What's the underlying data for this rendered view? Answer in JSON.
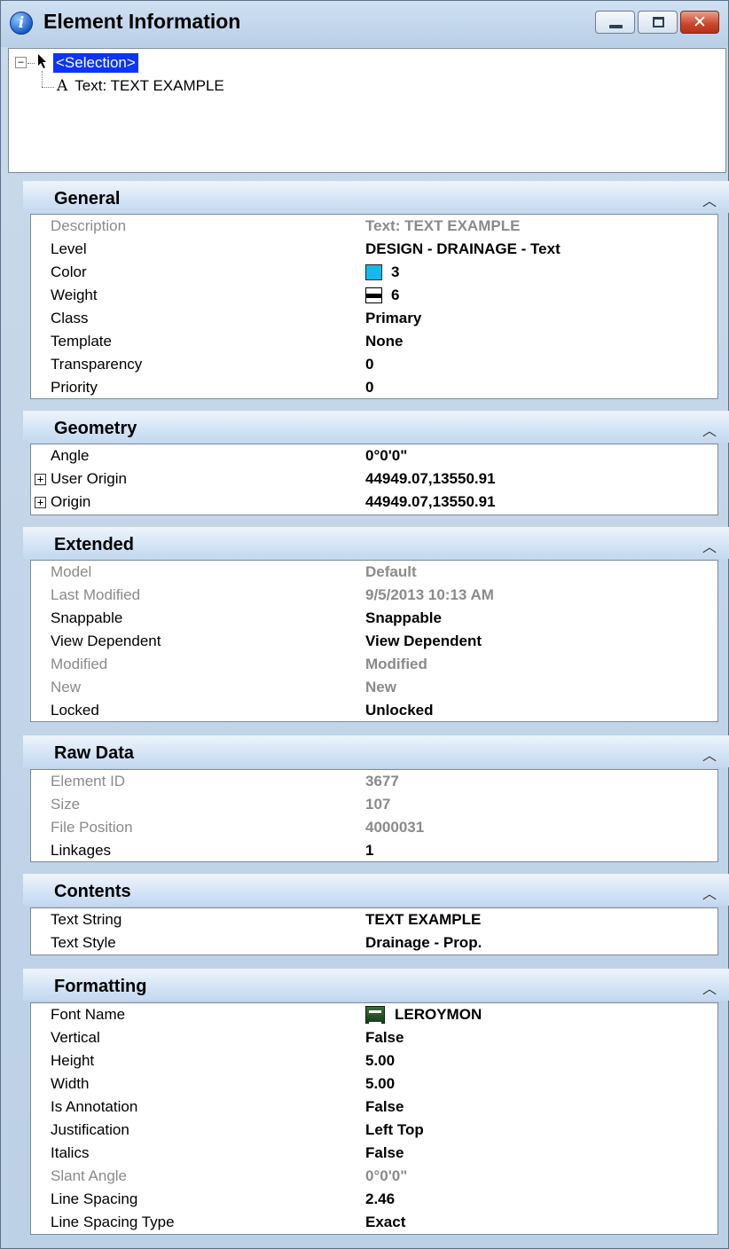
{
  "window": {
    "title": "Element Information",
    "icon": "info-icon"
  },
  "tree": {
    "root_label": "<Selection>",
    "child_icon_glyph": "A",
    "child_label": "Text: TEXT EXAMPLE"
  },
  "colors": {
    "selection_highlight": "#0a34ff",
    "level_color_swatch": "#14b9f0"
  },
  "sections": {
    "general": {
      "title": "General",
      "rows": [
        {
          "key": "Description",
          "value": "Text: TEXT EXAMPLE",
          "disabled": true
        },
        {
          "key": "Level",
          "value": "DESIGN - DRAINAGE - Text"
        },
        {
          "key": "Color",
          "value": "3"
        },
        {
          "key": "Weight",
          "value": "6"
        },
        {
          "key": "Class",
          "value": "Primary"
        },
        {
          "key": "Template",
          "value": "None"
        },
        {
          "key": "Transparency",
          "value": "0"
        },
        {
          "key": "Priority",
          "value": "0"
        }
      ]
    },
    "geometry": {
      "title": "Geometry",
      "rows": [
        {
          "key": "Angle",
          "value": "0°0'0\""
        },
        {
          "key": "User Origin",
          "value": "44949.07,13550.91"
        },
        {
          "key": "Origin",
          "value": "44949.07,13550.91"
        }
      ]
    },
    "extended": {
      "title": "Extended",
      "rows": [
        {
          "key": "Model",
          "value": "Default",
          "disabled": true
        },
        {
          "key": "Last Modified",
          "value": "9/5/2013 10:13 AM",
          "disabled": true
        },
        {
          "key": "Snappable",
          "value": "Snappable"
        },
        {
          "key": "View Dependent",
          "value": "View Dependent"
        },
        {
          "key": "Modified",
          "value": "Modified",
          "disabled": true
        },
        {
          "key": "New",
          "value": "New",
          "disabled": true
        },
        {
          "key": "Locked",
          "value": "Unlocked"
        }
      ]
    },
    "raw_data": {
      "title": "Raw Data",
      "rows": [
        {
          "key": "Element ID",
          "value": "3677",
          "disabled": true
        },
        {
          "key": "Size",
          "value": "107",
          "disabled": true
        },
        {
          "key": "File Position",
          "value": "4000031",
          "disabled": true
        },
        {
          "key": "Linkages",
          "value": "1"
        }
      ]
    },
    "contents": {
      "title": "Contents",
      "rows": [
        {
          "key": "Text String",
          "value": "TEXT EXAMPLE"
        },
        {
          "key": "Text Style",
          "value": "Drainage - Prop."
        }
      ]
    },
    "formatting": {
      "title": "Formatting",
      "rows": [
        {
          "key": "Font Name",
          "value": "LEROYMON"
        },
        {
          "key": "Vertical",
          "value": "False"
        },
        {
          "key": "Height",
          "value": "5.00"
        },
        {
          "key": "Width",
          "value": "5.00"
        },
        {
          "key": "Is Annotation",
          "value": "False"
        },
        {
          "key": "Justification",
          "value": "Left Top"
        },
        {
          "key": "Italics",
          "value": "False"
        },
        {
          "key": "Slant Angle",
          "value": "0°0'0\"",
          "disabled": true
        },
        {
          "key": "Line Spacing",
          "value": "2.46"
        },
        {
          "key": "Line Spacing Type",
          "value": "Exact"
        }
      ]
    }
  }
}
